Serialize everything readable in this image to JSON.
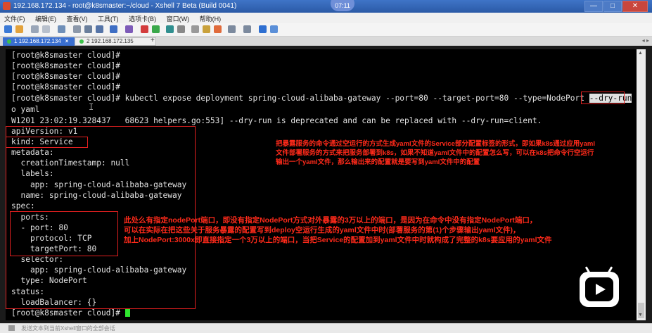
{
  "window": {
    "title": "192.168.172.134 - root@k8smaster:~/cloud - Xshell 7 Beta (Build 0041)",
    "recording_badge": "07:11",
    "minimize": "—",
    "maximize": "□",
    "close": "✕"
  },
  "menu": [
    "文件(F)",
    "编辑(E)",
    "查看(V)",
    "工具(T)",
    "选项卡(B)",
    "窗口(W)",
    "帮助(H)"
  ],
  "tabs": [
    {
      "label": "1 192.168.172.134",
      "close": "×"
    },
    {
      "label": "2 192.168.172.135"
    }
  ],
  "tab_add": "+",
  "tab_nav": "◂ ▸",
  "terminal": {
    "lines": [
      "[root@k8smaster cloud]#",
      "[root@k8smaster cloud]#",
      "[root@k8smaster cloud]#",
      "[root@k8smaster cloud]#",
      "o yaml",
      "W1201 23:02:19.328437   68623 helpers.go:553] --dry-run is deprecated and can be replaced with --dry-run=client.",
      "apiVersion: v1",
      "kind: Service",
      "metadata:",
      "  creationTimestamp: null",
      "  labels:",
      "    app: spring-cloud-alibaba-gateway",
      "  name: spring-cloud-alibaba-gateway",
      "spec:",
      "  ports:",
      "  - port: 80",
      "    protocol: TCP",
      "    targetPort: 80",
      "  selector:",
      "    app: spring-cloud-alibaba-gateway",
      "  type: NodePort",
      "status:",
      "  loadBalancer: {}",
      "[root@k8smaster cloud]#"
    ],
    "command_prefix": "[root@k8smaster cloud]# kubectl expose deployment spring-cloud-alibaba-gateway --port=80 --target-port=80 --type=NodePort ",
    "command_highlight": "--dry-run",
    "command_suffix": " -",
    "ibeam": "I"
  },
  "annotations": {
    "top_right": [
      "把暴露服务的命令通过空运行的方式生成yaml文件的Service部分配置标签的形式，即如果k8s通过应用yaml",
      "文件部署服务的方式来把服务部署到k8s，如果不知道yaml文件中的配置怎么写，可以在k8s把命令行空运行",
      "输出一个yaml文件，那么输出来的配置就是要写到yaml文件中的配置"
    ],
    "middle": [
      "此处么有指定nodePort端口，即没有指定NodePort方式对外暴露的3万以上的端口，是因为在命令中没有指定NodePort端口，",
      "可以在实际在把这些关于服务暴露的配置写到deploy空运行生成的yaml文件中时(部署服务的第(1)个步骤输出yaml文件)，",
      "加上NodePort:3000x即直接指定一个3万以上的端口，当把Service的配置加到yaml文件中时就构成了完整的k8s要应用的yaml文件"
    ]
  },
  "statusbar": {
    "text": "发送文本到当前Xshell窗口的全部会话"
  },
  "colors": {
    "annotation_red": "#ff2a1a",
    "terminal_bg": "#000000",
    "cursor_green": "#2fe82f",
    "title_blue": "#2b5aa6"
  }
}
